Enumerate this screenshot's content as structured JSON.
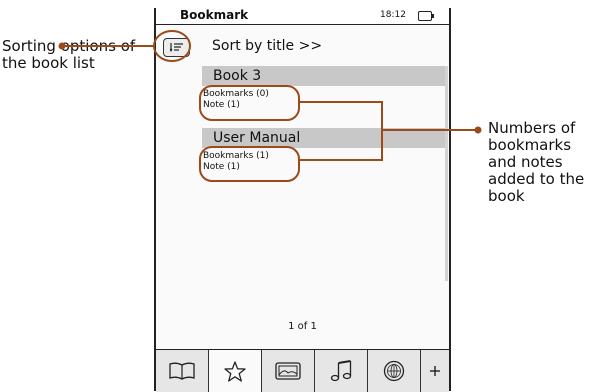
{
  "annotations": {
    "left": "Sorting options of the book list",
    "right": "Numbers of bookmarks and notes added to the book"
  },
  "status_bar": {
    "title": "Bookmark",
    "time": "18:12"
  },
  "sort": {
    "label": "Sort by title >>"
  },
  "books": [
    {
      "title": "Book 3",
      "bookmarks": "Bookmarks (0)",
      "notes": "Note (1)"
    },
    {
      "title": "User Manual",
      "bookmarks": "Bookmarks (1)",
      "notes": "Note (1)"
    }
  ],
  "pagination": "1 of 1",
  "tabs": [
    {
      "icon": "book-icon"
    },
    {
      "icon": "star-icon",
      "active": true
    },
    {
      "icon": "picture-icon"
    },
    {
      "icon": "music-note-icon"
    },
    {
      "icon": "globe-icon"
    },
    {
      "icon": "plus-icon"
    }
  ],
  "colors": {
    "callout": "#9c4a1a",
    "header_bg": "#c8c8c8",
    "tab_bg": "#e6e6e6"
  }
}
